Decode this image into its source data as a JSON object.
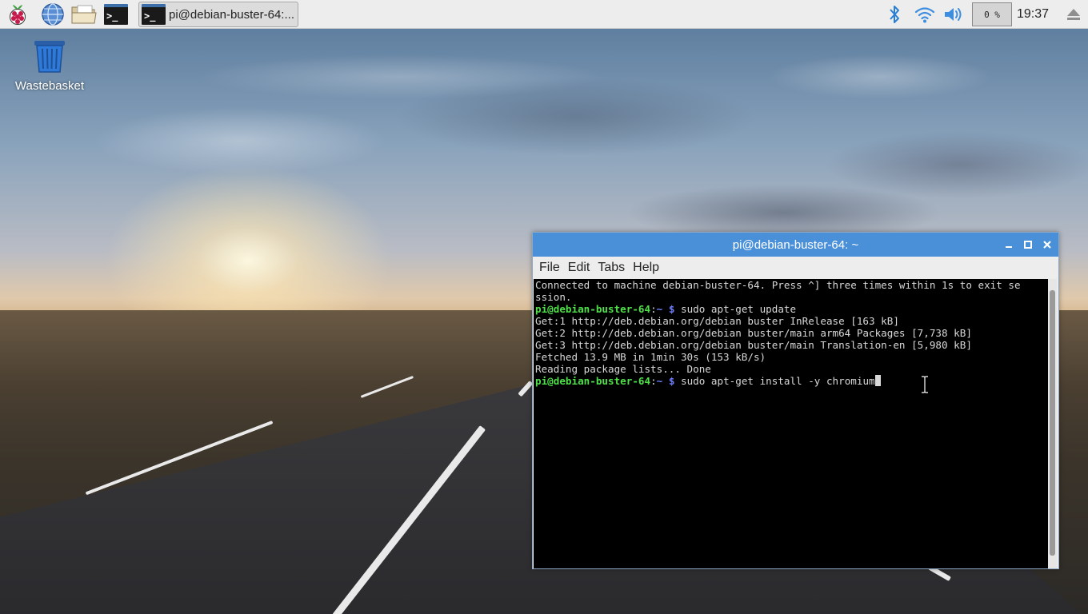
{
  "taskbar": {
    "task_label": "pi@debian-buster-64:...",
    "term_icon_glyph": ">_",
    "cpu_usage": "0 %",
    "clock": "19:37",
    "launchers": [
      "raspberry-menu-icon",
      "web-browser-icon",
      "file-manager-icon",
      "terminal-icon"
    ],
    "tray": [
      "bluetooth-icon",
      "wifi-icon",
      "volume-icon",
      "eject-icon"
    ]
  },
  "desktop": {
    "wastebasket_label": "Wastebasket"
  },
  "terminal": {
    "title": "pi@debian-buster-64: ~",
    "menu": {
      "file": "File",
      "edit": "Edit",
      "tabs": "Tabs",
      "help": "Help"
    },
    "lines": {
      "l1": "Connected to machine debian-buster-64. Press ^] three times within 1s to exit se",
      "l2": "ssion.",
      "l4": "Get:1 http://deb.debian.org/debian buster InRelease [163 kB]",
      "l5": "Get:2 http://deb.debian.org/debian buster/main arm64 Packages [7,738 kB]",
      "l6": "Get:3 http://deb.debian.org/debian buster/main Translation-en [5,980 kB]",
      "l7": "Fetched 13.9 MB in 1min 30s (153 kB/s)",
      "l8": "Reading package lists... Done"
    },
    "prompt": {
      "user": "pi@debian-buster-64",
      "sep": ":",
      "path": "~",
      "symbol": " $ "
    },
    "commands": {
      "c1": "sudo apt-get update",
      "c2": "sudo apt-get install -y chromium"
    }
  },
  "colors": {
    "titlebar": "#4a90d9",
    "prompt_user": "#4fe04a",
    "prompt_path": "#6f7fff",
    "panel": "#ededed"
  }
}
